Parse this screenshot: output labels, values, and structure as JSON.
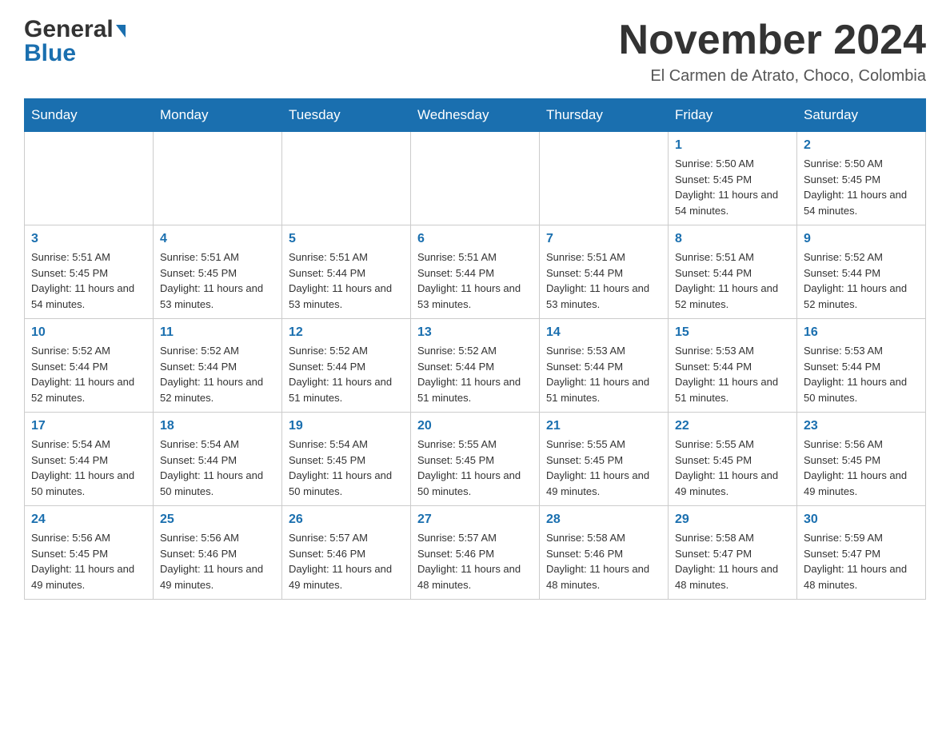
{
  "header": {
    "logo_main": "General",
    "logo_sub": "Blue",
    "month_title": "November 2024",
    "location": "El Carmen de Atrato, Choco, Colombia"
  },
  "days_of_week": [
    "Sunday",
    "Monday",
    "Tuesday",
    "Wednesday",
    "Thursday",
    "Friday",
    "Saturday"
  ],
  "weeks": [
    [
      {
        "day": "",
        "info": ""
      },
      {
        "day": "",
        "info": ""
      },
      {
        "day": "",
        "info": ""
      },
      {
        "day": "",
        "info": ""
      },
      {
        "day": "",
        "info": ""
      },
      {
        "day": "1",
        "info": "Sunrise: 5:50 AM\nSunset: 5:45 PM\nDaylight: 11 hours and 54 minutes."
      },
      {
        "day": "2",
        "info": "Sunrise: 5:50 AM\nSunset: 5:45 PM\nDaylight: 11 hours and 54 minutes."
      }
    ],
    [
      {
        "day": "3",
        "info": "Sunrise: 5:51 AM\nSunset: 5:45 PM\nDaylight: 11 hours and 54 minutes."
      },
      {
        "day": "4",
        "info": "Sunrise: 5:51 AM\nSunset: 5:45 PM\nDaylight: 11 hours and 53 minutes."
      },
      {
        "day": "5",
        "info": "Sunrise: 5:51 AM\nSunset: 5:44 PM\nDaylight: 11 hours and 53 minutes."
      },
      {
        "day": "6",
        "info": "Sunrise: 5:51 AM\nSunset: 5:44 PM\nDaylight: 11 hours and 53 minutes."
      },
      {
        "day": "7",
        "info": "Sunrise: 5:51 AM\nSunset: 5:44 PM\nDaylight: 11 hours and 53 minutes."
      },
      {
        "day": "8",
        "info": "Sunrise: 5:51 AM\nSunset: 5:44 PM\nDaylight: 11 hours and 52 minutes."
      },
      {
        "day": "9",
        "info": "Sunrise: 5:52 AM\nSunset: 5:44 PM\nDaylight: 11 hours and 52 minutes."
      }
    ],
    [
      {
        "day": "10",
        "info": "Sunrise: 5:52 AM\nSunset: 5:44 PM\nDaylight: 11 hours and 52 minutes."
      },
      {
        "day": "11",
        "info": "Sunrise: 5:52 AM\nSunset: 5:44 PM\nDaylight: 11 hours and 52 minutes."
      },
      {
        "day": "12",
        "info": "Sunrise: 5:52 AM\nSunset: 5:44 PM\nDaylight: 11 hours and 51 minutes."
      },
      {
        "day": "13",
        "info": "Sunrise: 5:52 AM\nSunset: 5:44 PM\nDaylight: 11 hours and 51 minutes."
      },
      {
        "day": "14",
        "info": "Sunrise: 5:53 AM\nSunset: 5:44 PM\nDaylight: 11 hours and 51 minutes."
      },
      {
        "day": "15",
        "info": "Sunrise: 5:53 AM\nSunset: 5:44 PM\nDaylight: 11 hours and 51 minutes."
      },
      {
        "day": "16",
        "info": "Sunrise: 5:53 AM\nSunset: 5:44 PM\nDaylight: 11 hours and 50 minutes."
      }
    ],
    [
      {
        "day": "17",
        "info": "Sunrise: 5:54 AM\nSunset: 5:44 PM\nDaylight: 11 hours and 50 minutes."
      },
      {
        "day": "18",
        "info": "Sunrise: 5:54 AM\nSunset: 5:44 PM\nDaylight: 11 hours and 50 minutes."
      },
      {
        "day": "19",
        "info": "Sunrise: 5:54 AM\nSunset: 5:45 PM\nDaylight: 11 hours and 50 minutes."
      },
      {
        "day": "20",
        "info": "Sunrise: 5:55 AM\nSunset: 5:45 PM\nDaylight: 11 hours and 50 minutes."
      },
      {
        "day": "21",
        "info": "Sunrise: 5:55 AM\nSunset: 5:45 PM\nDaylight: 11 hours and 49 minutes."
      },
      {
        "day": "22",
        "info": "Sunrise: 5:55 AM\nSunset: 5:45 PM\nDaylight: 11 hours and 49 minutes."
      },
      {
        "day": "23",
        "info": "Sunrise: 5:56 AM\nSunset: 5:45 PM\nDaylight: 11 hours and 49 minutes."
      }
    ],
    [
      {
        "day": "24",
        "info": "Sunrise: 5:56 AM\nSunset: 5:45 PM\nDaylight: 11 hours and 49 minutes."
      },
      {
        "day": "25",
        "info": "Sunrise: 5:56 AM\nSunset: 5:46 PM\nDaylight: 11 hours and 49 minutes."
      },
      {
        "day": "26",
        "info": "Sunrise: 5:57 AM\nSunset: 5:46 PM\nDaylight: 11 hours and 49 minutes."
      },
      {
        "day": "27",
        "info": "Sunrise: 5:57 AM\nSunset: 5:46 PM\nDaylight: 11 hours and 48 minutes."
      },
      {
        "day": "28",
        "info": "Sunrise: 5:58 AM\nSunset: 5:46 PM\nDaylight: 11 hours and 48 minutes."
      },
      {
        "day": "29",
        "info": "Sunrise: 5:58 AM\nSunset: 5:47 PM\nDaylight: 11 hours and 48 minutes."
      },
      {
        "day": "30",
        "info": "Sunrise: 5:59 AM\nSunset: 5:47 PM\nDaylight: 11 hours and 48 minutes."
      }
    ]
  ]
}
